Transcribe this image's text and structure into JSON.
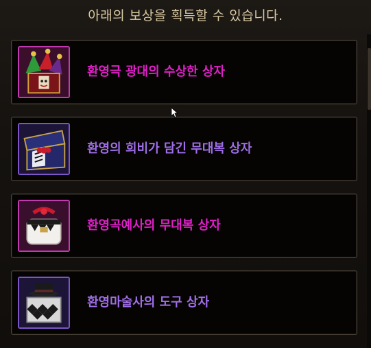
{
  "header": {
    "text": "아래의 보상을 획득할 수 있습니다."
  },
  "rewards": [
    {
      "name": "환영극 광대의 수상한 상자",
      "name_color": "#e020c8",
      "icon": "jester-hat-box-icon",
      "slot_color": "#c23ab0"
    },
    {
      "name": "환영의 희비가 담긴 무대복 상자",
      "name_color": "#a06ee8",
      "icon": "stage-costume-box-icon",
      "slot_color": "#7d55c8"
    },
    {
      "name": "환영곡예사의 무대복 상자",
      "name_color": "#e020c8",
      "icon": "acrobat-costume-box-icon",
      "slot_color": "#c23ab0"
    },
    {
      "name": "환영마술사의 도구 상자",
      "name_color": "#a06ee8",
      "icon": "magician-hat-box-icon",
      "slot_color": "#7d55c8"
    }
  ],
  "colors": {
    "header_text": "#d9c9a3",
    "row_border": "#4a4238",
    "background": "#120f0d"
  }
}
